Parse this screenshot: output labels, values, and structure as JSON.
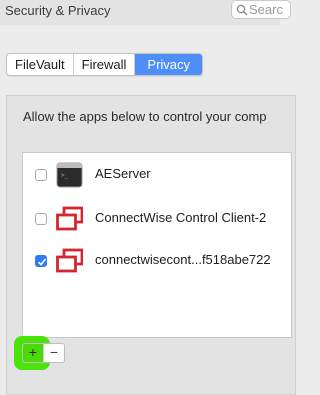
{
  "window": {
    "title": "Security & Privacy",
    "search_placeholder": "Searc"
  },
  "tabs": [
    {
      "label": "FileVault",
      "active": false
    },
    {
      "label": "Firewall",
      "active": false
    },
    {
      "label": "Privacy",
      "active": true
    }
  ],
  "privacy": {
    "description": "Allow the apps below to control your comp",
    "apps": [
      {
        "label": "AEServer",
        "checked": false,
        "icon": "terminal-app-icon"
      },
      {
        "label": "ConnectWise Control Client-2",
        "checked": false,
        "icon": "connectwise-icon"
      },
      {
        "label": "connectwisecont...f518abe722",
        "checked": true,
        "icon": "connectwise-icon"
      }
    ]
  },
  "controls": {
    "add_label": "+",
    "remove_label": "−"
  },
  "colors": {
    "accent": "#4d8ff6",
    "checkbox_on": "#2f7cf6",
    "connectwise_red": "#d3262f",
    "highlight_green": "#4be40a"
  }
}
